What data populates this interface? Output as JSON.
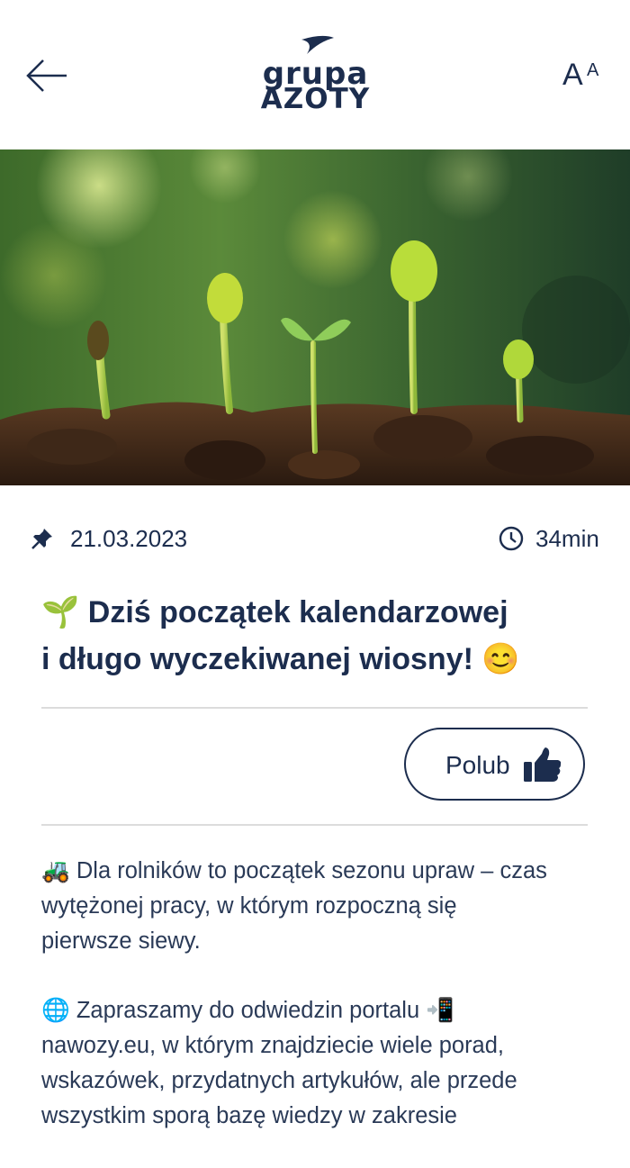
{
  "header": {
    "back_label": "←",
    "logo_line1": "grupa",
    "logo_line2": "AZOTY",
    "font_size_big": "A",
    "font_size_small": "A"
  },
  "hero": {
    "description_icon": "seedlings-image"
  },
  "article": {
    "date": "21.03.2023",
    "read_time": "34min",
    "title_emoji": "🌱",
    "title_line1": "Dziś początek kalendarzowej",
    "title_line2": "i długo wyczekiwanej wiosny!",
    "title_end_emoji": "😊",
    "like_label": "Polub",
    "paragraph1": {
      "emoji": "🚜",
      "line1": "Dla rolników to początek sezonu upraw – czas",
      "line2": "wytężonej pracy, w którym rozpoczną się",
      "line3": "pierwsze siewy."
    },
    "paragraph2": {
      "emoji": "🌐",
      "line1": "Zapraszamy do odwiedzin portalu",
      "line1_emoji": "📲",
      "line2": "nawozy.eu, w którym znajdziecie wiele porad,",
      "line3": "wskazówek, przydatnych artykułów, ale przede",
      "line4": "wszystkim sporą bazę wiedzy w zakresie"
    }
  },
  "colors": {
    "brand": "#1c2d4e",
    "divider": "#dcdcdc"
  }
}
